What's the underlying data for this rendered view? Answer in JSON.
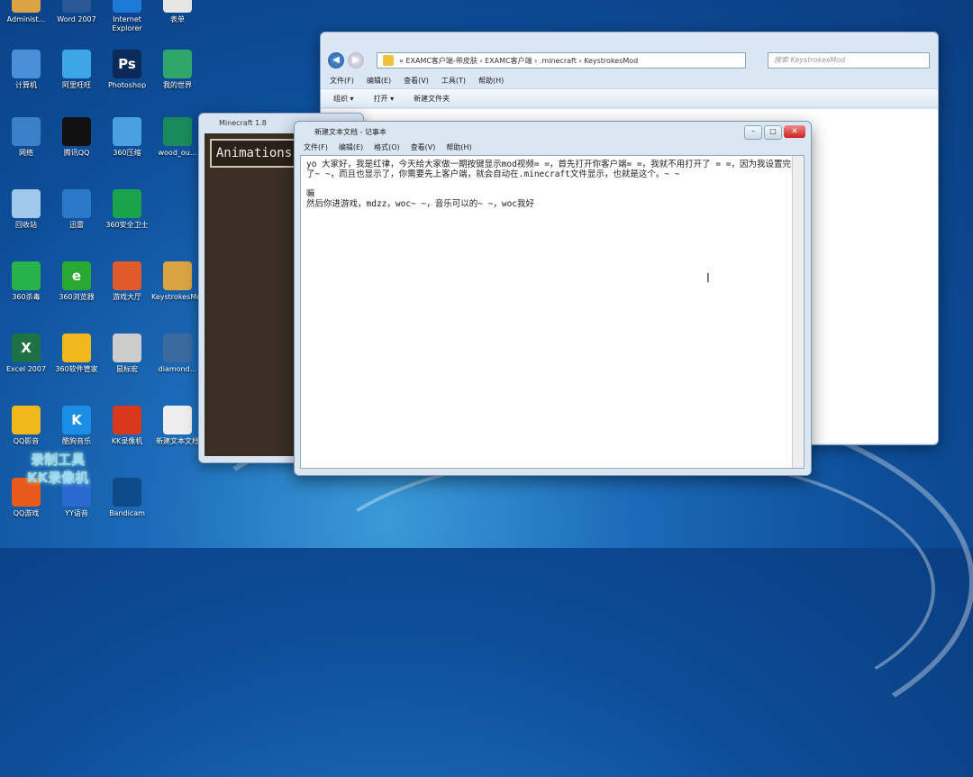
{
  "desktop": {
    "icons": [
      {
        "label": "Administ...",
        "icon": "user-folder-icon",
        "color": "#d9a441"
      },
      {
        "label": "Word 2007",
        "icon": "word-icon",
        "color": "#2b5797"
      },
      {
        "label": "Internet Explorer",
        "icon": "ie-icon",
        "color": "#1c7ad6"
      },
      {
        "label": "表单",
        "icon": "document-icon",
        "color": "#e6e6e6"
      },
      {
        "label": "计算机",
        "icon": "computer-icon",
        "color": "#4a90d9"
      },
      {
        "label": "阿里旺旺",
        "icon": "chat-icon",
        "color": "#3da6e6"
      },
      {
        "label": "Photoshop",
        "icon": "photoshop-icon",
        "color": "#0b2a5a",
        "glyph": "Ps"
      },
      {
        "label": "我的世界",
        "icon": "pickaxe-icon",
        "color": "#2fa66a"
      },
      {
        "label": "网络",
        "icon": "network-icon",
        "color": "#3a80c9"
      },
      {
        "label": "腾讯QQ",
        "icon": "qq-icon",
        "color": "#111111"
      },
      {
        "label": "360压缩",
        "icon": "archive-icon",
        "color": "#4aa0e0"
      },
      {
        "label": "wood_ou...",
        "icon": "sword-icon",
        "color": "#1a8a5a"
      },
      {
        "label": "回收站",
        "icon": "recycle-bin-icon",
        "color": "#9fc8ea"
      },
      {
        "label": "迅雷",
        "icon": "thunder-icon",
        "color": "#2a7ac8"
      },
      {
        "label": "360安全卫士",
        "icon": "shield-icon",
        "color": "#1aa34a"
      },
      {
        "label": "360杀毒",
        "icon": "antivirus-icon",
        "color": "#27b24a"
      },
      {
        "label": "360浏览器",
        "icon": "browser-icon",
        "color": "#29a832",
        "glyph": "e"
      },
      {
        "label": "游戏大厅",
        "icon": "game-icon",
        "color": "#e05a2a"
      },
      {
        "label": "KeystrokesMod",
        "icon": "folder-icon",
        "color": "#d9a441"
      },
      {
        "label": "Excel 2007",
        "icon": "excel-icon",
        "color": "#1e7145",
        "glyph": "X"
      },
      {
        "label": "360软件管家",
        "icon": "software-manager-icon",
        "color": "#f0b81c"
      },
      {
        "label": "鼠标宏",
        "icon": "mouse-icon",
        "color": "#cccccc"
      },
      {
        "label": "diamond...",
        "icon": "diamond-sword-icon",
        "color": "#3a6aa0"
      },
      {
        "label": "QQ影音",
        "icon": "player-icon",
        "color": "#f0b81c"
      },
      {
        "label": "酷狗音乐",
        "icon": "music-icon",
        "color": "#1c8ee6",
        "glyph": "K"
      },
      {
        "label": "KK录像机",
        "icon": "recorder-icon",
        "color": "#d8381c"
      },
      {
        "label": "新建文本文档",
        "icon": "text-file-icon",
        "color": "#eeeeee"
      },
      {
        "label": "QQ游戏",
        "icon": "qq-game-icon",
        "color": "#e85a1a"
      },
      {
        "label": "YY语音",
        "icon": "yy-icon",
        "color": "#2a6ad0"
      },
      {
        "label": "Bandicam",
        "icon": "bandicam-icon",
        "color": "#0c4a8a"
      }
    ],
    "watermark_line1": "录制工具",
    "watermark_line2": "KK录像机"
  },
  "explorer": {
    "address": "« EXAMC客户端-带皮肤 › EXAMC客户端 › .minecraft › KeystrokesMod",
    "search_placeholder": "搜索 KeystrokesMod",
    "menu": [
      "文件(F)",
      "编辑(E)",
      "查看(V)",
      "工具(T)",
      "帮助(H)"
    ],
    "toolbar": [
      "组织 ▾",
      "打开 ▾",
      "新建文件夹"
    ]
  },
  "minecraft": {
    "title": "Minecraft 1.8",
    "button": "Animations"
  },
  "notepad": {
    "title": "新建文本文档 - 记事本",
    "menu": [
      "文件(F)",
      "编辑(E)",
      "格式(O)",
      "查看(V)",
      "帮助(H)"
    ],
    "text": "yo 大家好，我是红律，今天给大家做一期按键显示mod视频= =，首先打开你客户端= =，我就不用打开了 = =，因为我设置完了~ ~，而且也显示了，你需要先上客户端，就会自动在.minecraft文件显示，也就是这个。~ ~\n\n嘛\n然后你进游戏，mdzz，woc~ ~，音乐可以的~ ~，woc我好"
  }
}
